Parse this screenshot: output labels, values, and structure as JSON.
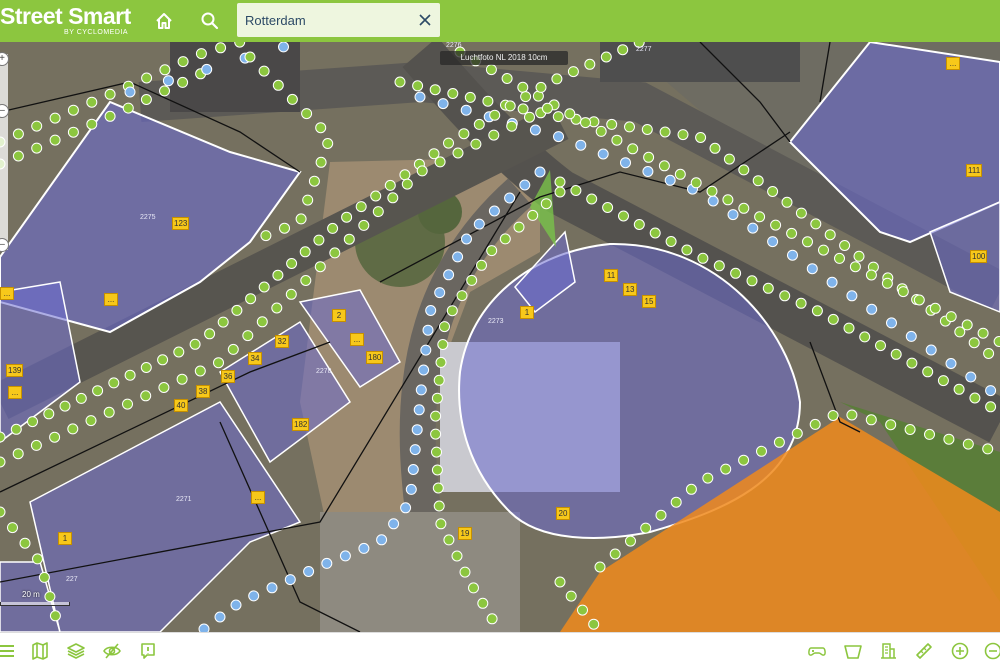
{
  "app": {
    "brand": "Street Smart",
    "brand_sub": "BY CYCLOMEDIA"
  },
  "search": {
    "value": "Rotterdam",
    "placeholder": ""
  },
  "map": {
    "photo_label": "Luchtfoto NL 2018 10cm",
    "scale_label": "20 m",
    "house_numbers": [
      "123",
      "111",
      "100",
      "139",
      "34",
      "32",
      "2",
      "180",
      "38",
      "36",
      "40",
      "182",
      "11",
      "13",
      "15",
      "1",
      "20",
      "19",
      "1"
    ],
    "parcel_numbers": [
      "2275",
      "2276",
      "2278",
      "2271",
      "2273",
      "227",
      "2277"
    ],
    "colors": {
      "accent": "#8cc63f",
      "building_overlay": "#6b6bcf",
      "highlight_parcel": "#f08a1c",
      "recording_green": "#8cc63f",
      "recording_blue": "#7fb3ea",
      "label": "#f7c81a"
    }
  },
  "icons": {
    "home": "home-icon",
    "search": "search-icon",
    "clear": "close-icon",
    "bottom_left": [
      "menu-icon",
      "map-icon",
      "layers-icon",
      "visibility-off-icon",
      "report-icon"
    ],
    "bottom_right": [
      "gamepad-icon",
      "box-icon",
      "buildings-icon",
      "ruler-icon",
      "zoom-in-icon",
      "zoom-out-icon"
    ]
  }
}
